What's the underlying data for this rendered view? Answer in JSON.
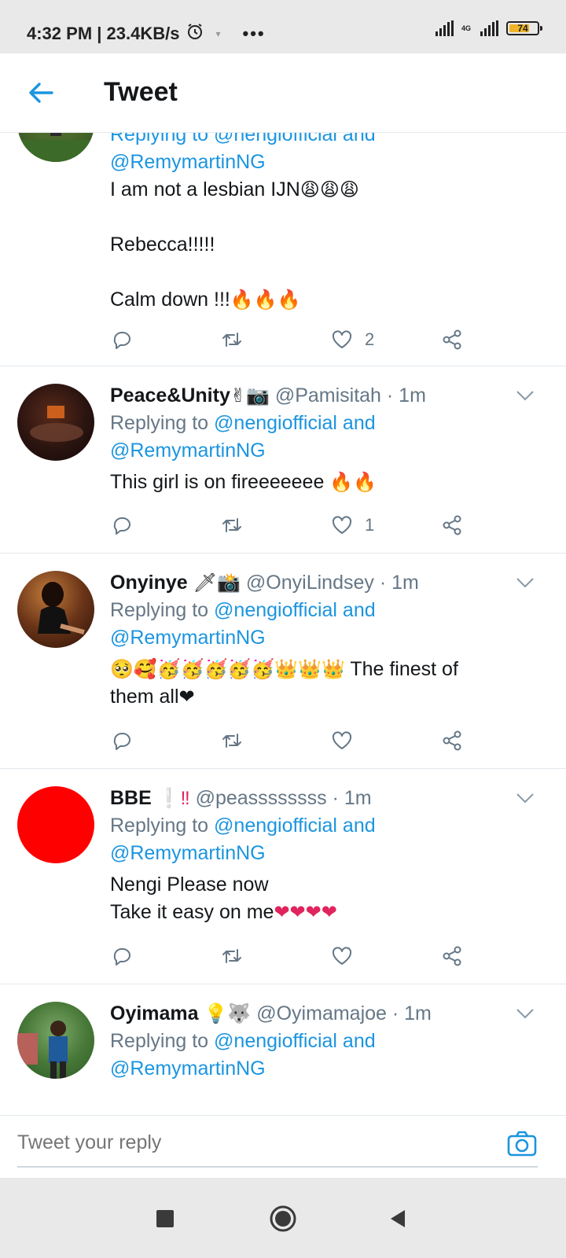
{
  "status_bar": {
    "time_speed": "4:32 PM | 23.4KB/s",
    "more_dots": "•••",
    "network": "4G",
    "battery": "74"
  },
  "header": {
    "title": "Tweet"
  },
  "accent_color": "#1b95e0",
  "tweets": [
    {
      "partial_reply_text": "Replying to @nengiofficial and",
      "reply_handles_2": "@RemymartinNG",
      "text_lines": [
        "I am not a lesbian IJN",
        "Rebecca!!!!!",
        "Calm down !!!"
      ],
      "emoji_1": "😩😩😩",
      "emoji_3": "🔥🔥🔥",
      "likes": "2"
    },
    {
      "name": "Peace&Unity",
      "name_emoji": "✌📷",
      "handle": "@Pamisitah · 1m",
      "replying_prefix": "Replying to ",
      "replying_link": "@nengiofficial and",
      "replying_link_2": "@RemymartinNG",
      "text": "This girl is on fireeeeeee",
      "text_emoji": "🔥🔥",
      "likes": "1"
    },
    {
      "name": "Onyinye",
      "name_emoji": "🗡📸",
      "handle": "@OnyiLindsey · 1m",
      "replying_prefix": "Replying to ",
      "replying_link": "@nengiofficial and",
      "replying_link_2": "@RemymartinNG",
      "text_emoji": "🥺🥰🥳🥳🥳🥳🥳👑👑👑",
      "text": " The finest of",
      "text_2": "them all",
      "text_2_emoji": "❤"
    },
    {
      "name": "BBE",
      "name_emoji": "❕‼",
      "handle": "@peassssssss · 1m",
      "replying_prefix": "Replying to ",
      "replying_link": "@nengiofficial and",
      "replying_link_2": "@RemymartinNG",
      "text": "Nengi Please now",
      "text_2": "Take it easy on me",
      "text_2_emoji": "❤❤❤❤"
    },
    {
      "name": "Oyimama",
      "name_emoji": "💡🐺",
      "handle": "@Oyimamajoe · 1m",
      "replying_prefix": "Replying to ",
      "replying_link": "@nengiofficial and",
      "replying_link_2": "@RemymartinNG"
    }
  ],
  "reply_bar": {
    "placeholder": "Tweet your reply"
  }
}
